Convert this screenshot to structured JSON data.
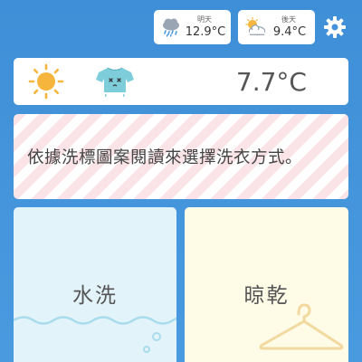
{
  "forecast": {
    "tomorrow": {
      "label": "明天",
      "temp": "12.9°C",
      "icon": "rain-cloud-icon"
    },
    "day_after": {
      "label": "後天",
      "temp": "9.4°C",
      "icon": "partly-cloudy-icon"
    }
  },
  "settings": {
    "icon": "gear-icon"
  },
  "current": {
    "temp": "7.7°C",
    "weather_icon": "sun-icon",
    "clothing_icon": "tshirt-icon"
  },
  "notice": {
    "text": "依據洗標圖案閱讀來選擇洗衣方式。"
  },
  "options": {
    "wash": {
      "label": "水洗",
      "icon": "water-waves-icon"
    },
    "dry": {
      "label": "晾乾",
      "icon": "hanger-icon"
    }
  },
  "colors": {
    "background": "#4a9ae0",
    "sun": "#f6b53c",
    "shirt": "#7ecdda",
    "wash_panel": "#e3f3fa",
    "dry_panel": "#fefbe6",
    "stripe": "#fbe4e8"
  }
}
